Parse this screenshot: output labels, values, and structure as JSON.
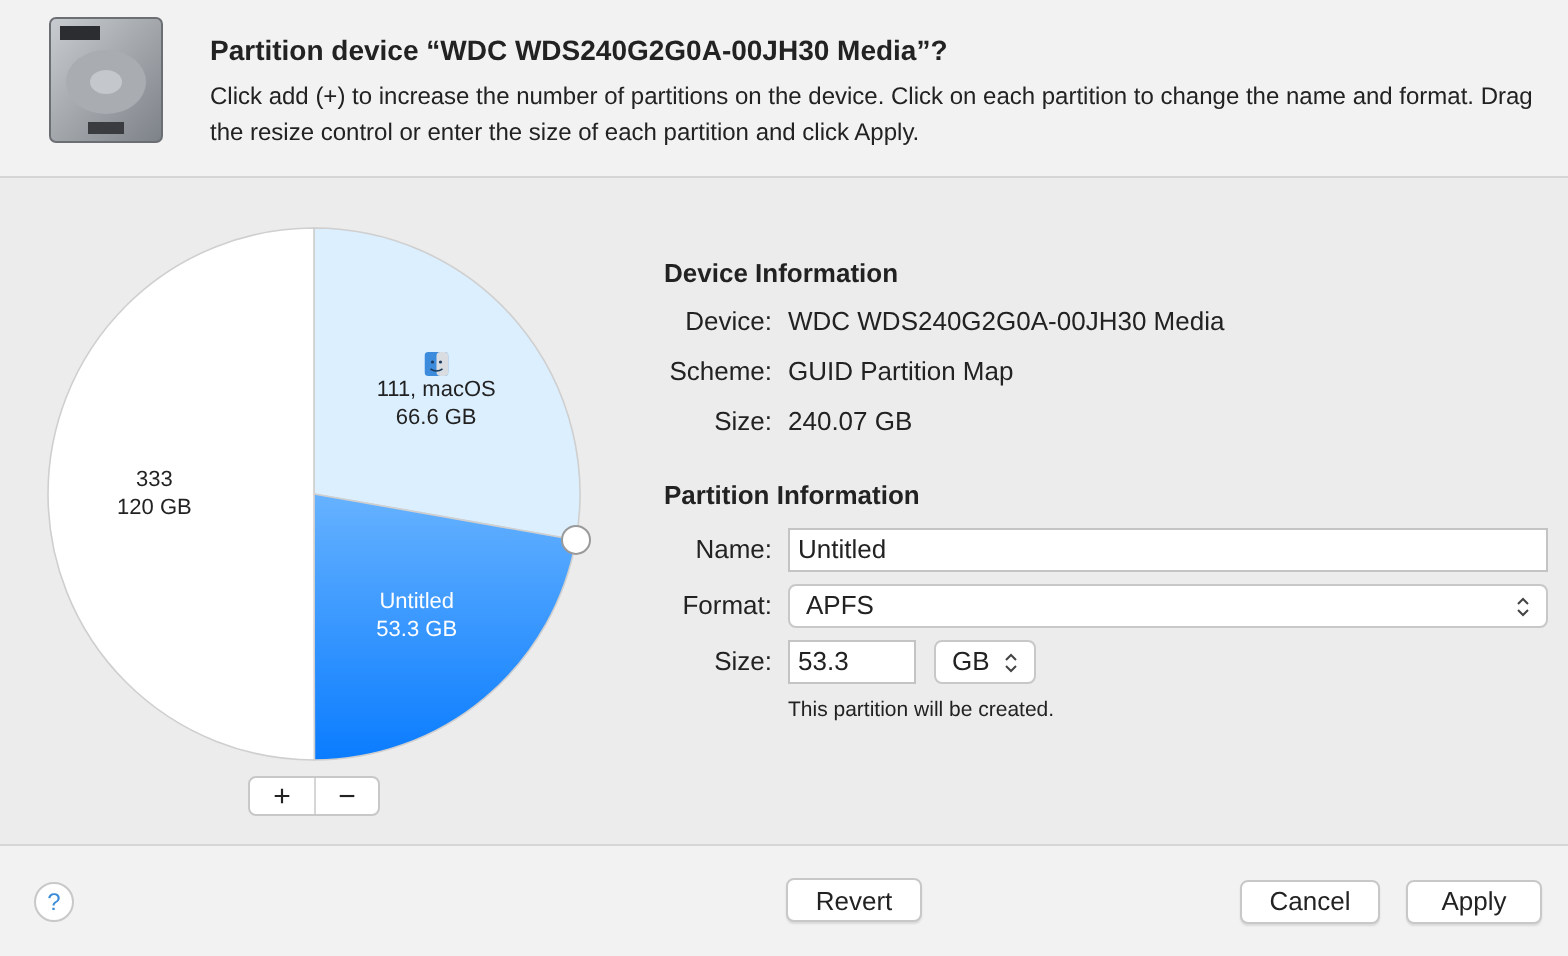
{
  "header": {
    "title": "Partition device “WDC WDS240G2G0A-00JH30 Media”?",
    "description": "Click add (+) to increase the number of partitions on the device. Click on each partition to change the name and format. Drag the resize control or enter the size of each partition and click Apply."
  },
  "partitions": [
    {
      "kind": "startup",
      "name": "111, macOS",
      "size": "66.6 GB",
      "selected": false
    },
    {
      "kind": "volume",
      "name": "Untitled",
      "size": "53.3 GB",
      "selected": true
    },
    {
      "kind": "volume",
      "name": "333",
      "size": "120 GB",
      "selected": false
    }
  ],
  "pie_buttons": [
    "+",
    "−"
  ],
  "device_info": {
    "heading": "Device Information",
    "rows": [
      {
        "label": "Device:",
        "value": "WDC WDS240G2G0A-00JH30 Media"
      },
      {
        "label": "Scheme:",
        "value": "GUID Partition Map"
      },
      {
        "label": "Size:",
        "value": "240.07 GB"
      }
    ]
  },
  "partition_info": {
    "heading": "Partition Information",
    "name_label": "Name:",
    "name_value": "Untitled",
    "format_label": "Format:",
    "format_value": "APFS",
    "size_label": "Size:",
    "size_value": "53.3",
    "unit": "GB",
    "note": "This partition will be created."
  },
  "footer": {
    "help": "?",
    "buttons": [
      "Revert",
      "Cancel",
      "Apply"
    ]
  }
}
